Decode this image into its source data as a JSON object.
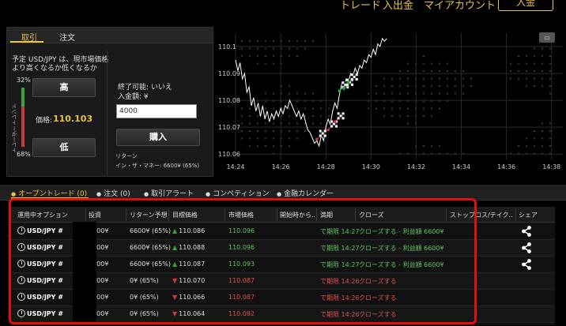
{
  "topnav": {
    "items": [
      {
        "label": "トレード"
      },
      {
        "label": "入出金"
      },
      {
        "label": "マイアカウント"
      }
    ],
    "button_label": "入金"
  },
  "trade_panel": {
    "tabs": [
      {
        "label": "取引",
        "active": true
      },
      {
        "label": "注文",
        "active": false
      }
    ],
    "question": "予定 USD/JPY は、現市場価格より高くなるか低くなるか",
    "trend_label": "トレーダートレンド",
    "trend_up_pct_label": "32%",
    "trend_down_pct_label": "68%",
    "trend_up_fraction": 0.32,
    "trend_down_fraction": 0.68,
    "high_button": "高",
    "low_button": "低",
    "price_label": "価格:",
    "price_value": "110.103",
    "end_available": "終了可能: いいえ",
    "deposit_label": "入金額: ¥",
    "deposit_value": "4000",
    "buy_button": "購入",
    "return_label": "リターン",
    "return_value": "イン・ザ・マネー: 6600¥ (65%)"
  },
  "chart_data": {
    "type": "line",
    "title": "",
    "xlabel": "",
    "ylabel": "",
    "x_tick_labels": [
      "14:24",
      "14:26",
      "14:28",
      "14:30",
      "14:32",
      "14:34",
      "14:36",
      "14:38"
    ],
    "y_tick_labels": [
      "110.1",
      "110.09",
      "110.08",
      "110.07",
      "110.06"
    ],
    "ylim": [
      110.058,
      110.105
    ],
    "xlim_minutes": [
      0,
      14.5
    ],
    "grid": true,
    "series": [
      {
        "points": [
          [
            0.0,
            110.095
          ],
          [
            0.1,
            110.091
          ],
          [
            0.2,
            110.094
          ],
          [
            0.3,
            110.088
          ],
          [
            0.4,
            110.09
          ],
          [
            0.5,
            110.083
          ],
          [
            0.6,
            110.085
          ],
          [
            0.7,
            110.078
          ],
          [
            0.8,
            110.081
          ],
          [
            0.9,
            110.076
          ],
          [
            1.0,
            110.079
          ],
          [
            1.1,
            110.074
          ],
          [
            1.2,
            110.078
          ],
          [
            1.3,
            110.073
          ],
          [
            1.4,
            110.076
          ],
          [
            1.5,
            110.072
          ],
          [
            1.6,
            110.075
          ],
          [
            1.7,
            110.073
          ],
          [
            1.8,
            110.076
          ],
          [
            1.9,
            110.074
          ],
          [
            2.0,
            110.077
          ],
          [
            2.1,
            110.075
          ],
          [
            2.2,
            110.078
          ],
          [
            2.3,
            110.077
          ],
          [
            2.4,
            110.08
          ],
          [
            2.5,
            110.078
          ],
          [
            2.6,
            110.076
          ],
          [
            2.7,
            110.074
          ],
          [
            2.8,
            110.076
          ],
          [
            2.9,
            110.073
          ],
          [
            3.0,
            110.075
          ],
          [
            3.1,
            110.072
          ],
          [
            3.2,
            110.069
          ],
          [
            3.3,
            110.068
          ],
          [
            3.4,
            110.066
          ],
          [
            3.5,
            110.064
          ],
          [
            3.6,
            110.065
          ],
          [
            3.7,
            110.063
          ],
          [
            3.8,
            110.067
          ],
          [
            3.9,
            110.065
          ],
          [
            4.0,
            110.07
          ],
          [
            4.1,
            110.073
          ],
          [
            4.2,
            110.071
          ],
          [
            4.3,
            110.076
          ],
          [
            4.4,
            110.079
          ],
          [
            4.5,
            110.077
          ],
          [
            4.6,
            110.082
          ],
          [
            4.7,
            110.086
          ],
          [
            4.8,
            110.084
          ],
          [
            4.9,
            110.088
          ],
          [
            5.0,
            110.087
          ],
          [
            5.1,
            110.09
          ],
          [
            5.2,
            110.089
          ],
          [
            5.3,
            110.092
          ],
          [
            5.4,
            110.09
          ],
          [
            5.5,
            110.093
          ],
          [
            5.6,
            110.092
          ],
          [
            5.7,
            110.095
          ],
          [
            5.8,
            110.094
          ],
          [
            5.9,
            110.097
          ],
          [
            6.0,
            110.096
          ],
          [
            6.1,
            110.099
          ],
          [
            6.2,
            110.097
          ],
          [
            6.3,
            110.101
          ],
          [
            6.4,
            110.1
          ],
          [
            6.5,
            110.103
          ],
          [
            6.6,
            110.102
          ],
          [
            6.7,
            110.103
          ]
        ]
      }
    ],
    "markers": [
      {
        "x": 3.6,
        "y": 110.0655,
        "direction": "down"
      },
      {
        "x": 4.1,
        "y": 110.069,
        "direction": "down"
      },
      {
        "x": 4.4,
        "y": 110.072,
        "direction": "down"
      },
      {
        "x": 4.6,
        "y": 110.0835,
        "direction": "up"
      },
      {
        "x": 4.8,
        "y": 110.0845,
        "direction": "up"
      },
      {
        "x": 5.0,
        "y": 110.0865,
        "direction": "up"
      }
    ]
  },
  "bottom_tabs": [
    {
      "label": "オープントレード (0)",
      "active": true
    },
    {
      "label": "注文 (0)",
      "active": false
    },
    {
      "label": "取引アラート",
      "active": false
    },
    {
      "label": "コンペティション",
      "active": false
    },
    {
      "label": "金融カレンダー",
      "active": false
    }
  ],
  "table": {
    "headers": [
      "運用中オプション",
      "投資",
      "リターン予想",
      "目標価格",
      "市場価格",
      "開始時から...",
      "満期",
      "クローズ",
      "ストップロス/テイク...",
      "シェア"
    ],
    "rows": [
      {
        "symbol": "USD/JPY #",
        "invest": "4000¥",
        "expected": "6600¥ (65%)",
        "target": "110.086",
        "target_dir": "up",
        "market": "110.096",
        "market_dir": "up",
        "since": "",
        "expiry": "で期限 14:27",
        "close": "クローズする - 利益額 6600¥",
        "close_dir": "up",
        "share": true
      },
      {
        "symbol": "USD/JPY #",
        "invest": "4000¥",
        "expected": "6600¥ (65%)",
        "target": "110.088",
        "target_dir": "up",
        "market": "110.096",
        "market_dir": "up",
        "since": "",
        "expiry": "で期限 14:27",
        "close": "クローズする - 利益額 6600¥",
        "close_dir": "up",
        "share": true
      },
      {
        "symbol": "USD/JPY #",
        "invest": "4000¥",
        "expected": "6600¥ (65%)",
        "target": "110.087",
        "target_dir": "up",
        "market": "110.093",
        "market_dir": "up",
        "since": "",
        "expiry": "で期限 14:27",
        "close": "クローズする - 利益額 6600¥",
        "close_dir": "up",
        "share": true
      },
      {
        "symbol": "USD/JPY #",
        "invest": "4000¥",
        "expected": "0¥ (65%)",
        "target": "110.070",
        "target_dir": "down",
        "market": "110.087",
        "market_dir": "down",
        "since": "",
        "expiry": "で期限 14:26",
        "close": "クローズする",
        "close_dir": "down",
        "share": false
      },
      {
        "symbol": "USD/JPY #",
        "invest": "4000¥",
        "expected": "0¥ (65%)",
        "target": "110.066",
        "target_dir": "down",
        "market": "110.087",
        "market_dir": "down",
        "since": "",
        "expiry": "で期限 14:26",
        "close": "クローズする",
        "close_dir": "down",
        "share": false
      },
      {
        "symbol": "USD/JPY #",
        "invest": "4000¥",
        "expected": "0¥ (65%)",
        "target": "110.064",
        "target_dir": "down",
        "market": "110.082",
        "market_dir": "down",
        "since": "",
        "expiry": "で期限 14:26",
        "close": "クローズする",
        "close_dir": "down",
        "share": false
      }
    ]
  },
  "colors": {
    "accent": "#e8c24a",
    "up": "#5fc15f",
    "down": "#e05050",
    "highlight": "#e01010"
  }
}
